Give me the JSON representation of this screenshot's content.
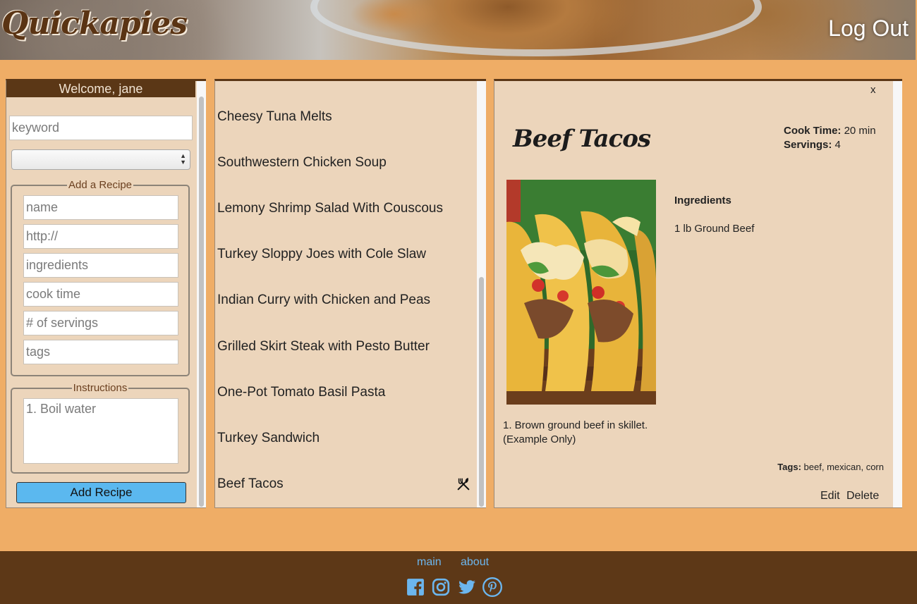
{
  "header": {
    "logo": "Quickapies",
    "logout_label": "Log Out"
  },
  "sidebar": {
    "welcome": "Welcome, jane",
    "search_placeholder": "keyword",
    "select_value": "",
    "add_recipe_legend": "Add a Recipe",
    "fields": {
      "name": "name",
      "url": "http://",
      "ingredients": "ingredients",
      "cook_time": "cook time",
      "servings": "# of servings",
      "tags": "tags"
    },
    "instructions_legend": "Instructions",
    "instructions_placeholder": "1. Boil water",
    "add_button": "Add Recipe"
  },
  "recipe_list": [
    "Cheesy Tuna Melts",
    "Southwestern Chicken Soup",
    "Lemony Shrimp Salad With Couscous",
    "Turkey Sloppy Joes with Cole Slaw",
    "Indian Curry with Chicken and Peas",
    "Grilled Skirt Steak with Pesto Butter",
    "One-Pot Tomato Basil Pasta",
    "Turkey Sandwich",
    "Beef Tacos"
  ],
  "detail": {
    "close_label": "x",
    "title": "Beef Tacos",
    "cook_time_label": "Cook Time:",
    "cook_time_value": "20 min",
    "servings_label": "Servings:",
    "servings_value": "4",
    "ingredients_heading": "Ingredients",
    "ingredients": [
      "1 lb Ground Beef"
    ],
    "instructions_line1": "1. Brown ground beef in skillet.",
    "instructions_line2": "(Example Only)",
    "tags_label": "Tags:",
    "tags_value": "beef, mexican, corn",
    "edit_label": "Edit",
    "delete_label": "Delete"
  },
  "footer": {
    "links": [
      "main",
      "about"
    ],
    "social_icons": [
      "facebook-icon",
      "instagram-icon",
      "twitter-icon",
      "pinterest-icon"
    ]
  },
  "colors": {
    "page_bg": "#efad66",
    "brown": "#5b3716",
    "panel_bg": "#ecd5bb",
    "button_blue": "#5bb8ef",
    "link_blue": "#6cb6ee"
  }
}
